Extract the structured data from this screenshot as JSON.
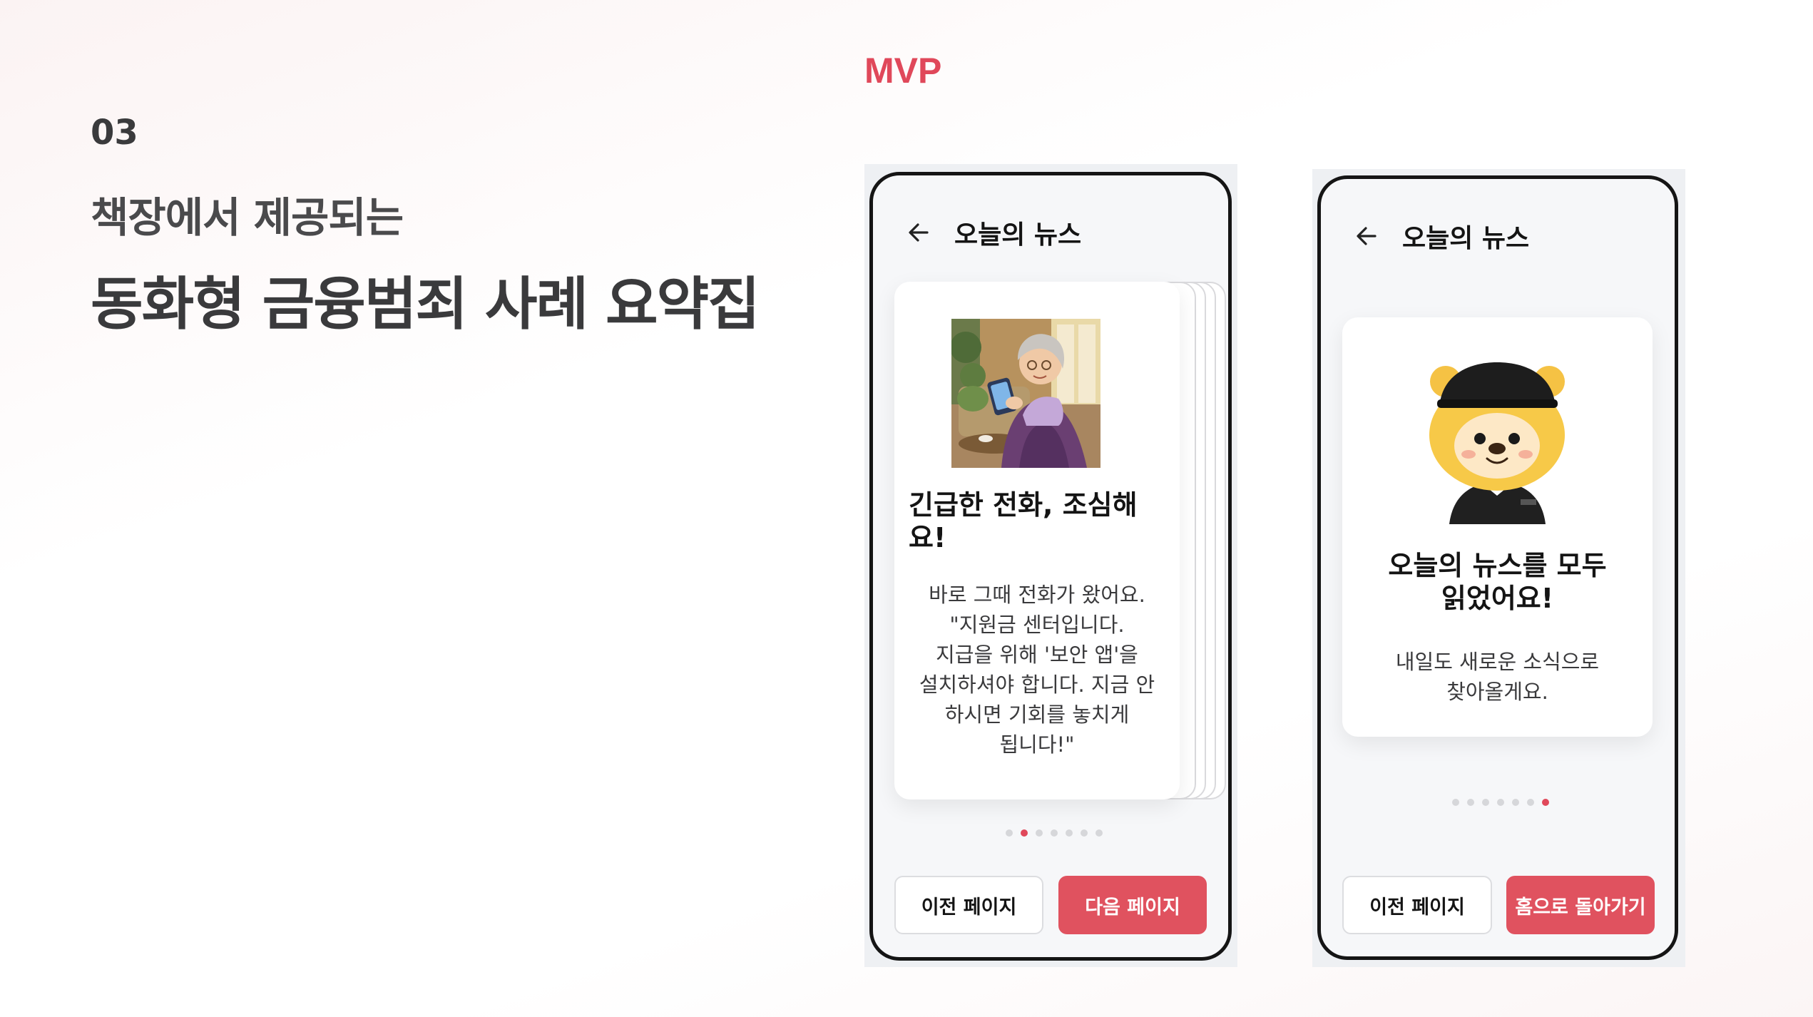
{
  "slide": {
    "section_number": "03",
    "subtitle": "책장에서 제공되는",
    "headline": "동화형 금융범죄 사례 요약집",
    "mvp_label": "MVP"
  },
  "screen1": {
    "header_title": "오늘의 뉴스",
    "back_icon": "arrow-left-icon",
    "card_title_lines": [
      "긴급한 전화, 조심해",
      "요!"
    ],
    "card_body_lines": [
      "바로 그때 전화가 왔어요.",
      "\"지원금 센터입니다.",
      "지급을 위해 '보안 앱'을",
      "설치하셔야 합니다. 지금 안",
      "하시면 기회를 놓치게",
      "됩니다!\""
    ],
    "page_dots": {
      "total": 7,
      "active_index": 1
    },
    "prev_button": "이전 페이지",
    "next_button": "다음 페이지"
  },
  "screen2": {
    "header_title": "오늘의 뉴스",
    "back_icon": "arrow-left-icon",
    "card_title_lines": [
      "오늘의 뉴스를 모두",
      "읽었어요!"
    ],
    "card_body_lines": [
      "내일도 새로운 소식으로",
      "찾아올게요."
    ],
    "page_dots": {
      "total": 7,
      "active_index": 6
    },
    "prev_button": "이전 페이지",
    "home_button": "홈으로 돌아가기"
  },
  "colors": {
    "accent": "#e0485a",
    "button_primary": "#e0525f",
    "text_dark": "#3a3a3c"
  }
}
